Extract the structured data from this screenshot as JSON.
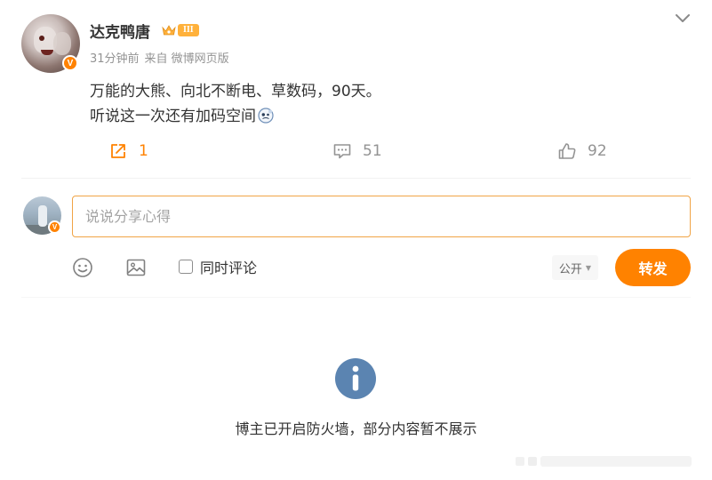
{
  "post": {
    "username": "达克鸭唐",
    "level_badge": "III",
    "verified_mark": "V",
    "time": "31分钟前",
    "source": "来自 微博网页版",
    "text_line1": "万能的大熊、向北不断电、草数码，90天。",
    "text_line2": "听说这一次还有加码空间",
    "inline_emoji": "thinking-emoji",
    "actions": {
      "repost_count": "1",
      "comment_count": "51",
      "like_count": "92"
    }
  },
  "composer": {
    "placeholder": "说说分享心得",
    "verified_mark": "V",
    "sync_comment_label": "同时评论",
    "visibility": "公开",
    "submit_label": "转发"
  },
  "notice": {
    "text": "博主已开启防火墙，部分内容暂不展示",
    "icon": "info-icon"
  },
  "colors": {
    "accent": "#ff8200",
    "badge": "#ffb13b",
    "muted": "#939393",
    "info_blue": "#5b84b1",
    "input_border": "#f0a446"
  }
}
